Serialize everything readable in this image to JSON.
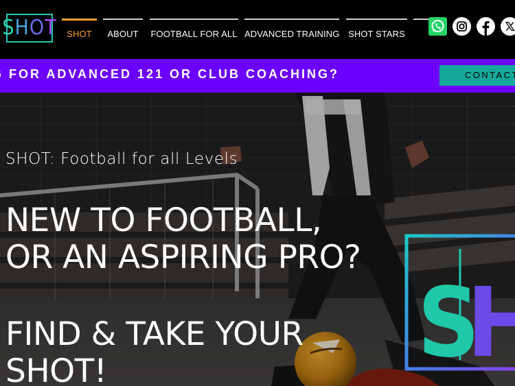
{
  "logo": {
    "letters": [
      "S",
      "H",
      "O",
      "T"
    ]
  },
  "nav": {
    "items": [
      {
        "label": "SHOT",
        "active": true
      },
      {
        "label": "ABOUT",
        "active": false
      },
      {
        "label": "FOOTBALL FOR ALL",
        "active": false
      },
      {
        "label": "ADVANCED TRAINING",
        "active": false
      },
      {
        "label": "SHOT STARS",
        "active": false
      }
    ]
  },
  "socials": {
    "icons": [
      "whatsapp-icon",
      "instagram-icon",
      "facebook-icon",
      "x-icon"
    ]
  },
  "banner": {
    "text": "G FOR ADVANCED 121 OR CLUB COACHING?",
    "contact_label": "CONTACT"
  },
  "hero": {
    "subtitle": "SHOT: Football for all Levels",
    "headline_1": "NEW TO FOOTBALL,",
    "headline_2": "OR AN ASPIRING PRO?",
    "headline_3": "FIND & TAKE YOUR",
    "headline_4": "SHOT!",
    "sign_letters": [
      "S",
      "H"
    ]
  },
  "colors": {
    "accent_orange": "#f4a23c",
    "banner_purple": "#6b00ff",
    "button_teal": "#14a89a",
    "whatsapp_green": "#25d366"
  }
}
